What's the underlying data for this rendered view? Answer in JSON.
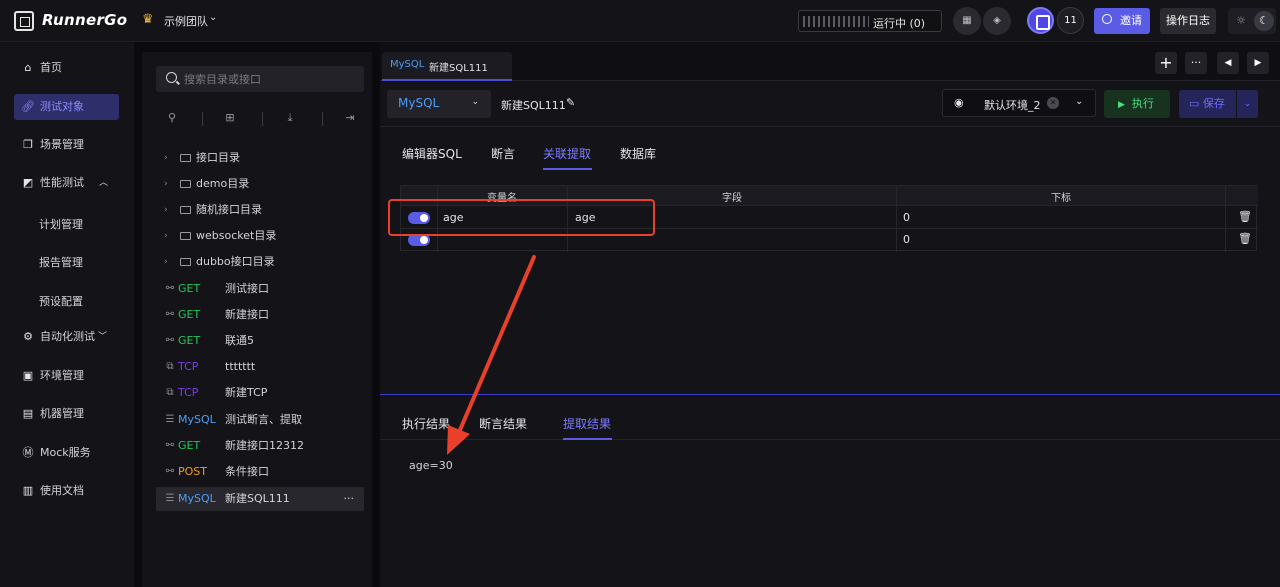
{
  "app": {
    "name": "RunnerGo",
    "team": "示例团队"
  },
  "topbar": {
    "status_label": "运行中",
    "status_count": "(0)",
    "member_count": "11",
    "invite_label": "邀请",
    "oplog_label": "操作日志"
  },
  "nav": {
    "items": [
      {
        "label": "首页",
        "icon": "home-icon"
      },
      {
        "label": "测试对象",
        "icon": "link-icon",
        "active": true
      },
      {
        "label": "场景管理",
        "icon": "scene-icon"
      },
      {
        "label": "性能测试",
        "icon": "chart-icon"
      },
      {
        "label": "计划管理"
      },
      {
        "label": "报告管理"
      },
      {
        "label": "预设配置"
      },
      {
        "label": "自动化测试",
        "icon": "auto-icon"
      },
      {
        "label": "环境管理",
        "icon": "env-icon"
      },
      {
        "label": "机器管理",
        "icon": "machine-icon"
      },
      {
        "label": "Mock服务",
        "icon": "mock-icon"
      },
      {
        "label": "使用文档",
        "icon": "doc-icon"
      }
    ]
  },
  "tree": {
    "search_placeholder": "搜索目录或接口",
    "folders": [
      "接口目录",
      "demo目录",
      "随机接口目录",
      "websocket目录",
      "dubbo接口目录"
    ],
    "apis": [
      {
        "method": "GET",
        "name": "测试接口",
        "color": "#22c55e"
      },
      {
        "method": "GET",
        "name": "新建接口",
        "color": "#22c55e"
      },
      {
        "method": "GET",
        "name": "联通5",
        "color": "#22c55e"
      },
      {
        "method": "TCP",
        "name": "ttttttt",
        "color": "#7c3aed"
      },
      {
        "method": "TCP",
        "name": "新建TCP",
        "color": "#7c3aed"
      },
      {
        "method": "MySQL",
        "name": "测试断言、提取",
        "color": "#4f9cf5"
      },
      {
        "method": "GET",
        "name": "新建接口12312",
        "color": "#22c55e"
      },
      {
        "method": "POST",
        "name": "条件接口",
        "color": "#f59e0b"
      },
      {
        "method": "MySQL",
        "name": "新建SQL111",
        "color": "#4f9cf5",
        "selected": true
      }
    ],
    "more_label": "···"
  },
  "main": {
    "tab": {
      "method": "MySQL",
      "name": "新建SQL111"
    },
    "db_type": "MySQL",
    "request_name": "新建SQL111",
    "env_name": "默认环境_2",
    "run_label": "执行",
    "save_label": "保存",
    "sub_tabs": [
      "编辑器SQL",
      "断言",
      "关联提取",
      "数据库"
    ],
    "active_sub_tab": "关联提取",
    "table": {
      "headers": [
        "变量名",
        "字段",
        "下标"
      ],
      "rows": [
        {
          "enabled": true,
          "var": "age",
          "field": "age",
          "index": "0"
        },
        {
          "enabled": true,
          "var": "",
          "field": "",
          "index": "0"
        }
      ]
    },
    "result_tabs": [
      "执行结果",
      "断言结果",
      "提取结果"
    ],
    "active_result_tab": "提取结果",
    "result_text": "age=30"
  },
  "colors": {
    "accent": "#5b5ce6",
    "highlight": "#e8402a",
    "get": "#22c55e",
    "mysql": "#4f9cf5",
    "tcp": "#7c3aed",
    "post": "#f59e0b"
  }
}
